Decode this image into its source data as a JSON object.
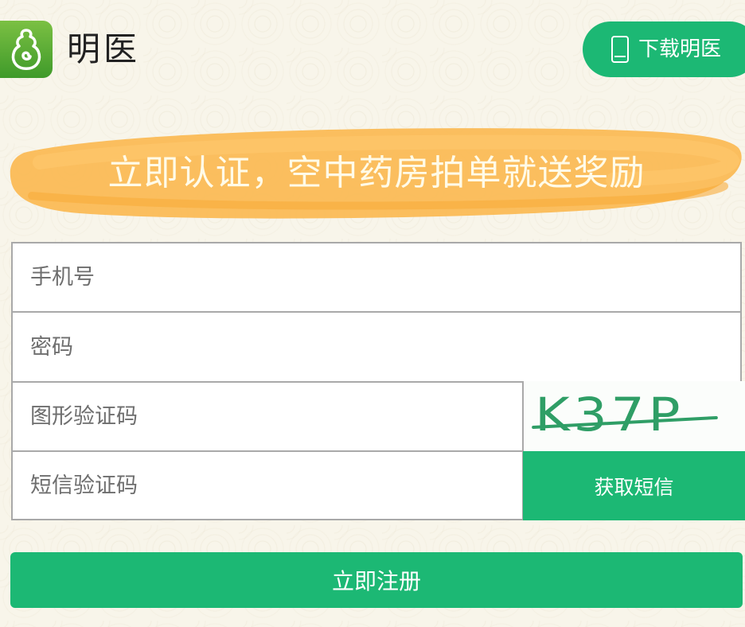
{
  "header": {
    "brand_name": "明医",
    "download_label": "下载明医"
  },
  "banner": {
    "text": "立即认证，空中药房拍单就送奖励"
  },
  "form": {
    "phone_placeholder": "手机号",
    "password_placeholder": "密码",
    "captcha_placeholder": "图形验证码",
    "captcha_text": "K37P",
    "sms_placeholder": "短信验证码",
    "sms_button_label": "获取短信",
    "register_button_label": "立即注册"
  },
  "colors": {
    "primary_green": "#1cb874",
    "banner_orange": "#fbb84f",
    "logo_green": "#5aaf35"
  }
}
